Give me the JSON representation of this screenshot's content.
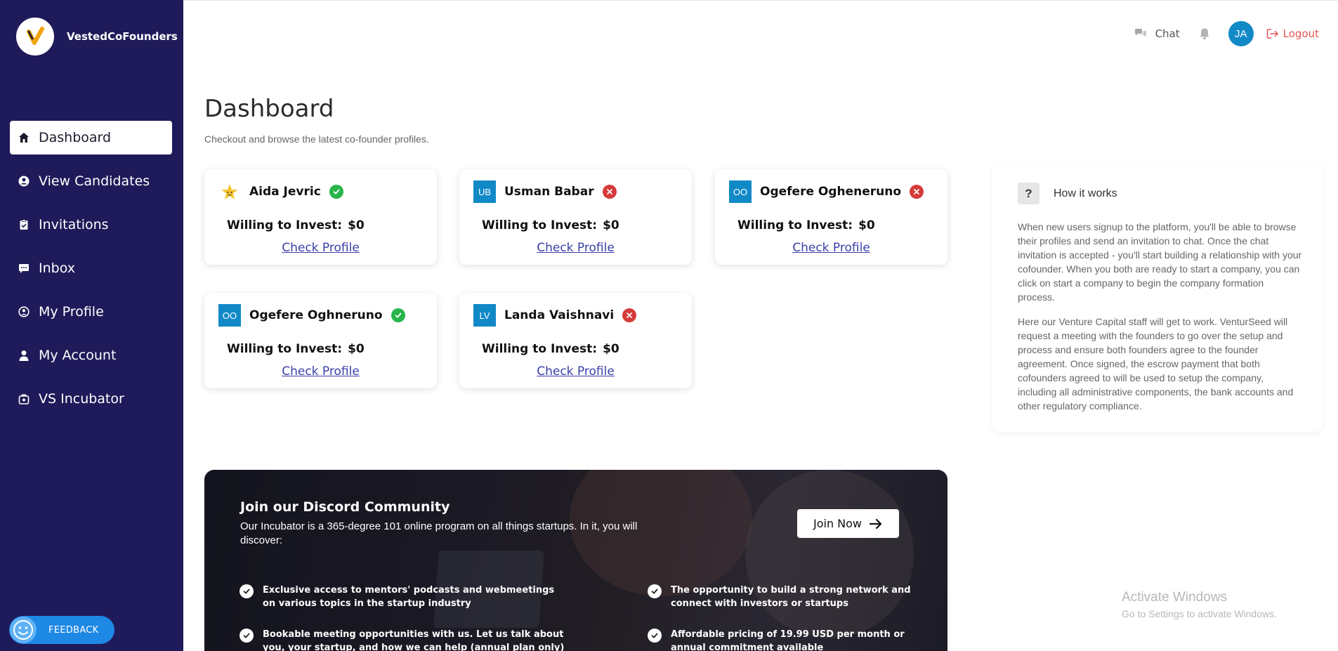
{
  "brand": {
    "name": "VestedCoFounders"
  },
  "sidebar": {
    "items": [
      {
        "label": "Dashboard",
        "icon": "home-icon",
        "active": true
      },
      {
        "label": "View Candidates",
        "icon": "user-circle-icon",
        "active": false
      },
      {
        "label": "Invitations",
        "icon": "clipboard-check-icon",
        "active": false
      },
      {
        "label": "Inbox",
        "icon": "chat-bubble-icon",
        "active": false
      },
      {
        "label": "My Profile",
        "icon": "user-circle-outline-icon",
        "active": false
      },
      {
        "label": "My Account",
        "icon": "user-icon",
        "active": false
      },
      {
        "label": "VS Incubator",
        "icon": "rocket-box-icon",
        "active": false
      }
    ],
    "feedback_label": "FEEDBACK"
  },
  "topbar": {
    "chat_label": "Chat",
    "avatar_initials": "JA",
    "logout_label": "Logout"
  },
  "main": {
    "title": "Dashboard",
    "subtitle": "Checkout and browse the latest co-founder profiles.",
    "cards": [
      {
        "name": "Aida Jevric",
        "initials": "",
        "avatar": "star-avatar",
        "status": "accepted",
        "invest_label": "Willing to Invest:",
        "invest_value": "$0",
        "link": "Check Profile"
      },
      {
        "name": "Usman Babar",
        "initials": "UB",
        "status": "declined",
        "invest_label": "Willing to Invest:",
        "invest_value": "$0",
        "link": "Check Profile"
      },
      {
        "name": "Ogefere Ogheneruno",
        "initials": "OO",
        "status": "declined",
        "invest_label": "Willing to Invest:",
        "invest_value": "$0",
        "link": "Check Profile"
      },
      {
        "name": "Ogefere Oghneruno",
        "initials": "OO",
        "status": "accepted",
        "invest_label": "Willing to Invest:",
        "invest_value": "$0",
        "link": "Check Profile"
      },
      {
        "name": "Landa Vaishnavi",
        "initials": "LV",
        "status": "declined",
        "invest_label": "Willing to Invest:",
        "invest_value": "$0",
        "link": "Check Profile"
      }
    ]
  },
  "how_it_works": {
    "title": "How it works",
    "q_mark": "?",
    "para1": "When new users signup to the platform, you'll be able to browse their profiles and send an invitation to chat. Once the chat invitation is accepted - you'll start building a relationship with your cofounder. When you both are ready to start a company, you can click on start a company to begin the company formation process.",
    "para2": "Here our Venture Capital staff will get to work. VenturSeed will request a meeting with the founders to go over the setup and process and ensure both founders agree to the founder agreement. Once signed, the escrow payment that both cofounders agreed to will be used to setup the company, including all administrative components, the bank accounts and other regulatory compliance."
  },
  "discord": {
    "title": "Join our Discord Community",
    "description": "Our Incubator is a 365-degree 101 online program on all things startups. In it, you will discover:",
    "join_label": "Join Now",
    "features": [
      "Exclusive access to mentors' podcasts and webmeetings on various topics in the startup industry",
      "The opportunity to build a strong network and connect with investors or startups",
      "Bookable meeting opportunities with us. Let us talk about you, your startup, and how we can help (annual plan only)",
      "Affordable pricing of 19.99 USD per month or annual commitment available"
    ]
  },
  "watermark": {
    "line1": "Activate Windows",
    "line2": "Go to Settings to activate Windows."
  },
  "colors": {
    "sidebar_bg": "#1f1a59",
    "avatar_blue": "#1289c7",
    "status_ok": "#27b54a",
    "status_no": "#d63a3a",
    "logout": "#e55353",
    "link": "#3a3fa8",
    "feedback": "#1e88e5"
  }
}
